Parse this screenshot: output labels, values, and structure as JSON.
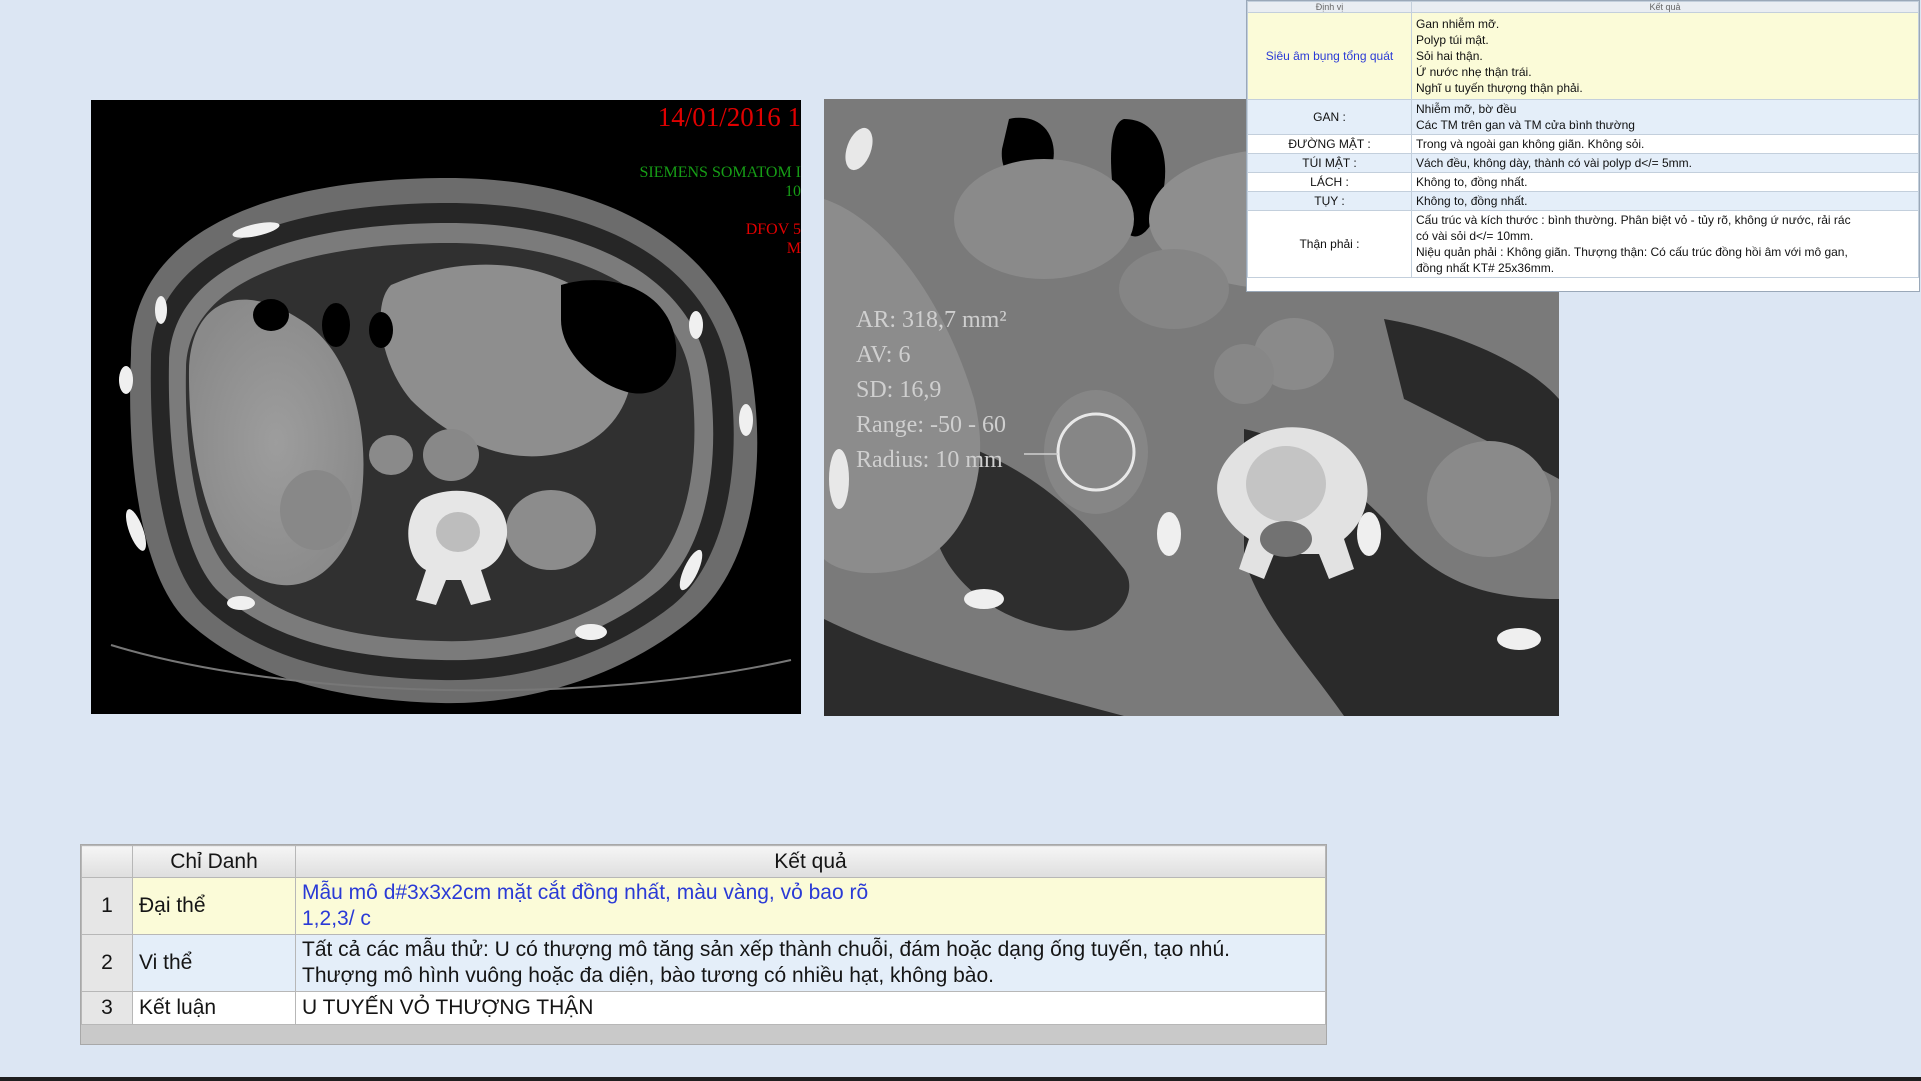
{
  "ct_left": {
    "date": "14/01/2016 1",
    "scanner_line1": "SIEMENS SOMATOM I",
    "scanner_line2": "10",
    "dfov_line1": "DFOV 5",
    "dfov_line2": "M"
  },
  "ct_right": {
    "roi": [
      "AR: 318,7 mm²",
      "AV: 6",
      "SD: 16,9",
      "Range: -50 - 60",
      "Radius: 10 mm"
    ]
  },
  "ultrasound_report": {
    "header_left": "Định vị",
    "header_right": "Kết quả",
    "rows": [
      {
        "label": "Siêu âm bụng tổng quát",
        "lines": [
          "Gan nhiễm mỡ.",
          "Polyp túi mật.",
          "Sỏi hai thận.",
          "Ứ nước nhẹ thận trái.",
          "Nghĩ u tuyến thượng thận phải."
        ]
      },
      {
        "label": "GAN :",
        "lines": [
          "Nhiễm mỡ, bờ đều",
          "Các TM trên gan và TM cửa bình thường"
        ]
      },
      {
        "label": "ĐƯỜNG MẬT :",
        "lines": [
          "Trong và ngoài gan không giãn. Không sỏi."
        ]
      },
      {
        "label": "TÚI MẬT :",
        "lines": [
          "Vách đều, không dày, thành có vài polyp d</= 5mm."
        ]
      },
      {
        "label": "LÁCH :",
        "lines": [
          "Không to, đồng nhất."
        ]
      },
      {
        "label": "TỤY :",
        "lines": [
          "Không to, đồng nhất."
        ]
      },
      {
        "label": "Thận phải :",
        "lines": [
          "Cấu trúc và kích thước : bình thường. Phân biệt vỏ - tủy rõ, không ứ nước, rải rác",
          "có vài sỏi d</= 10mm.",
          "Niệu quản phải : Không giãn. Thượng thận: Có cấu trúc đồng hồi âm với mô gan,",
          "đồng nhất KT# 25x36mm."
        ]
      }
    ]
  },
  "pathology": {
    "col_name": "Chỉ Danh",
    "col_result": "Kết quả",
    "rows": [
      {
        "num": "1",
        "name": "Đại thể",
        "lines": [
          "Mẫu mô d#3x3x2cm mặt cắt đồng nhất, màu vàng, vỏ bao rõ",
          "1,2,3/ c"
        ]
      },
      {
        "num": "2",
        "name": "Vi thể",
        "lines": [
          "Tất cả các mẫu thử: U có thượng mô tăng sản xếp thành chuỗi, đám hoặc dạng ống tuyến, tạo nhú.",
          "Thượng mô hình vuông hoặc đa diện, bào tương có nhiều hạt, không bào."
        ]
      },
      {
        "num": "3",
        "name": "Kết luận",
        "lines": [
          "U TUYẾN VỎ THƯỢNG THẬN"
        ]
      }
    ]
  }
}
